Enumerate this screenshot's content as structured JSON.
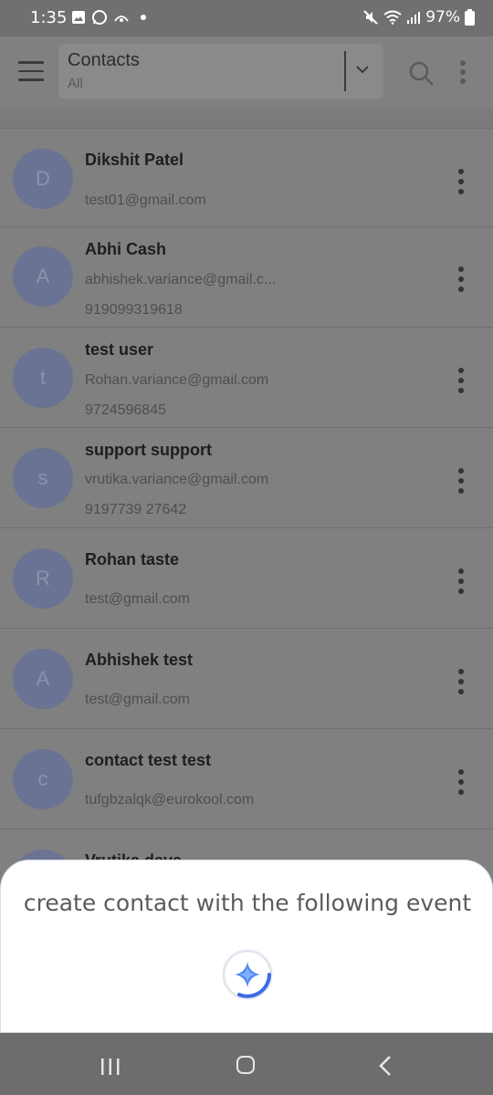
{
  "status_bar": {
    "time": "1:35",
    "battery": "97%",
    "left_icons": [
      "image-icon",
      "whatsapp-icon",
      "cast-icon"
    ],
    "right_icons": [
      "mute-icon",
      "wifi-icon",
      "signal-icon",
      "battery-icon"
    ]
  },
  "header": {
    "title": "Contacts",
    "subtitle": "All"
  },
  "contacts": [
    {
      "initial": "D",
      "name": "Dikshit Patel",
      "email": "test01@gmail.com",
      "phone": ""
    },
    {
      "initial": "A",
      "name": "Abhi Cash",
      "email": "abhishek.variance@gmail.c...",
      "phone": "919099319618"
    },
    {
      "initial": "t",
      "name": "test user",
      "email": "Rohan.variance@gmail.com",
      "phone": "9724596845"
    },
    {
      "initial": "s",
      "name": "support support",
      "email": "vrutika.variance@gmail.com",
      "phone": "9197739 27642"
    },
    {
      "initial": "R",
      "name": "Rohan taste",
      "email": "test@gmail.com",
      "phone": ""
    },
    {
      "initial": "A",
      "name": "Abhishek test",
      "email": "test@gmail.com",
      "phone": ""
    },
    {
      "initial": "c",
      "name": "contact test test",
      "email": "tufgbzalqk@eurokool.com",
      "phone": ""
    },
    {
      "initial": "",
      "name": "Vrutika dave",
      "email": "",
      "phone": ""
    }
  ],
  "assistant_sheet": {
    "prompt": "create contact with the following event"
  },
  "colors": {
    "avatar_bg": "#6a7393",
    "accent_blue": "#3d6be5",
    "overlay": "#7f7f7f"
  }
}
